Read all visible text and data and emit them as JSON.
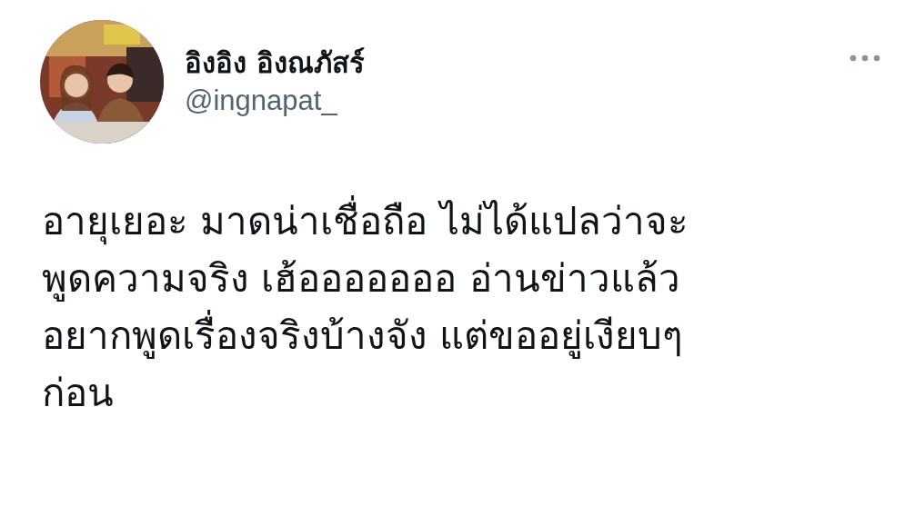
{
  "tweet": {
    "display_name": "อิงอิง อิงณภัสร์",
    "handle": "@ingnapat_",
    "text": "อายุเยอะ มาดน่าเชื่อถือ ไม่ได้แปลว่าจะ\nพูดความจริง เฮ้อออออออ อ่านข่าวแล้ว\nอยากพูดเรื่องจริงบ้างจัง แต่ขออยู่เงียบๆ\nก่อน"
  }
}
